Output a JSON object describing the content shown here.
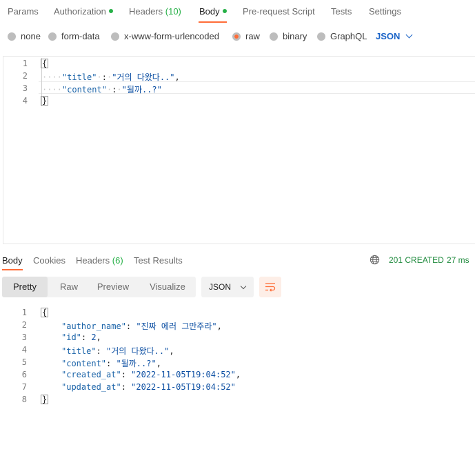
{
  "request_tabs": {
    "params": "Params",
    "authorization": "Authorization",
    "headers": "Headers",
    "headers_count": "(10)",
    "body": "Body",
    "pre_request": "Pre-request Script",
    "tests": "Tests",
    "settings": "Settings"
  },
  "body_types": {
    "none": "none",
    "form_data": "form-data",
    "urlencoded": "x-www-form-urlencoded",
    "raw": "raw",
    "binary": "binary",
    "graphql": "GraphQL",
    "selected": "raw",
    "format": "JSON"
  },
  "request_editor": {
    "line_numbers": [
      "1",
      "2",
      "3",
      "4"
    ],
    "open_brace": "{",
    "close_brace": "}",
    "title_key": "\"title\"",
    "title_value": "\"거의 다왔다..\"",
    "content_key": "\"content\"",
    "content_value": "\"될까..?\""
  },
  "response_tabs": {
    "body": "Body",
    "cookies": "Cookies",
    "headers": "Headers",
    "headers_count": "(6)",
    "test_results": "Test Results"
  },
  "response_status": {
    "status": "201 CREATED",
    "time": "27 ms"
  },
  "view_modes": {
    "pretty": "Pretty",
    "raw": "Raw",
    "preview": "Preview",
    "visualize": "Visualize",
    "format": "JSON"
  },
  "response_body": {
    "line_numbers": [
      "1",
      "2",
      "3",
      "4",
      "5",
      "6",
      "7",
      "8"
    ],
    "open_brace": "{",
    "close_brace": "}",
    "author_name_key": "\"author_name\"",
    "author_name_value": "\"진짜 에러 그만주라\"",
    "id_key": "\"id\"",
    "id_value": "2",
    "title_key": "\"title\"",
    "title_value": "\"거의 다왔다..\"",
    "content_key": "\"content\"",
    "content_value": "\"될까..?\"",
    "created_at_key": "\"created_at\"",
    "created_at_value": "\"2022-11-05T19:04:52\"",
    "updated_at_key": "\"updated_at\"",
    "updated_at_value": "\"2022-11-05T19:04:52\""
  },
  "colors": {
    "accent": "#ff6c37",
    "success": "#26b047",
    "link": "#1a63c7"
  },
  "icons": {
    "globe": "globe-icon",
    "wrap": "wrap-lines-icon",
    "chevron": "chevron-down-icon"
  }
}
